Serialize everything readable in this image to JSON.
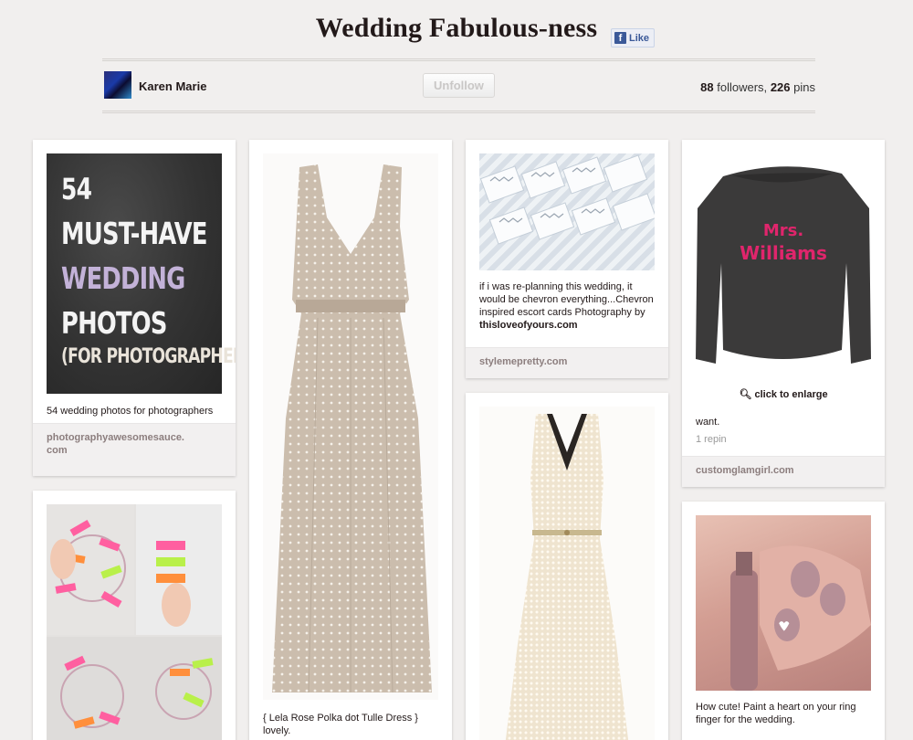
{
  "board": {
    "title": "Wedding Fabulous-ness",
    "like_label": "Like",
    "like_icon": "facebook-icon"
  },
  "owner": {
    "name": "Karen Marie",
    "avatar_icon": "avatar-image"
  },
  "actions": {
    "unfollow_label": "Unfollow"
  },
  "stats": {
    "followers": "88",
    "followers_label": "followers,",
    "pins": "226",
    "pins_label": "pins"
  },
  "pins": [
    {
      "image_text": [
        "54",
        "MUST-HAVE",
        "WEDDING",
        "PHOTOS",
        "(FOR PHOTOGRAPHERS)"
      ],
      "description": "54 wedding photos for photographers",
      "source_line1": "photographyawesomesauce.",
      "source_line2": "com"
    },
    {
      "description_line1": "{ Lela Rose Polka dot Tulle Dress }",
      "description_line2": "lovely."
    },
    {
      "description": "if i was re-planning this wedding, it would be chevron everything...Chevron inspired escort cards Photography by",
      "description_link": "thisloveofyours.com",
      "source": "stylemepretty.com"
    },
    {
      "image_text": "Mrs. Williams",
      "enlarge_label": "click to enlarge",
      "description": "want.",
      "repins": "1 repin",
      "source": "customglamgirl.com"
    },
    {
      "description": "How cute! Paint a heart on your ring finger for the wedding."
    }
  ],
  "colors": {
    "background": "#f1efee",
    "title": "#221919",
    "source_text": "#8c7e7e",
    "shirt_text": "#e0256c"
  }
}
